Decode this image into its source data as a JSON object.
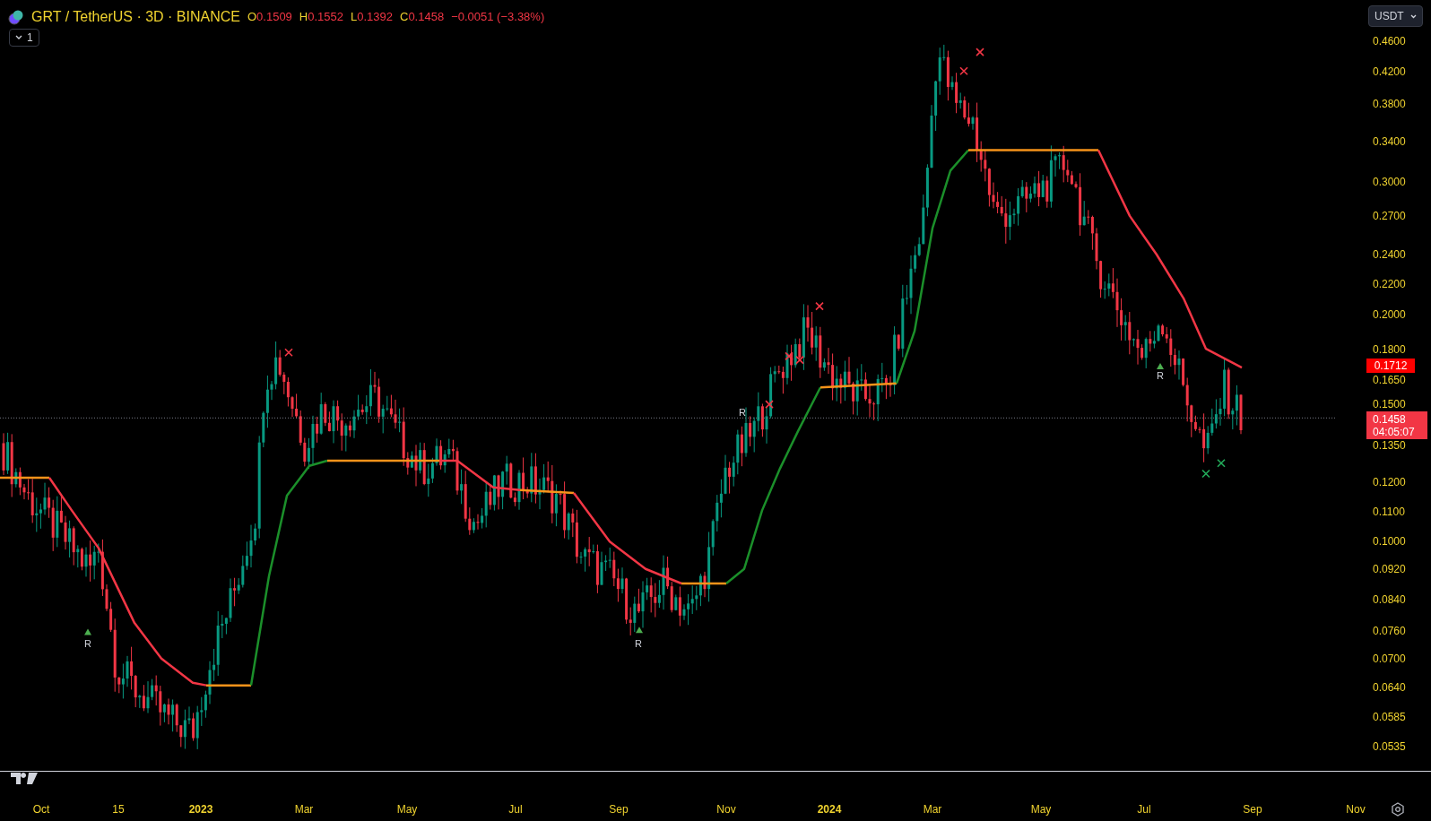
{
  "symbol": {
    "title": "GRT / TetherUS · 3D · BINANCE",
    "ohlc": [
      {
        "label": "O",
        "value": "0.1509"
      },
      {
        "label": "H",
        "value": "0.1552"
      },
      {
        "label": "L",
        "value": "0.1392"
      },
      {
        "label": "C",
        "value": "0.1458"
      }
    ],
    "change": "−0.0051 (−3.38%)"
  },
  "indicator_toggle": {
    "count": "1",
    "expanded": false
  },
  "currency_button": "USDT",
  "price_axis": {
    "ticks": [
      "0.4600",
      "0.4200",
      "0.3800",
      "0.3400",
      "0.3000",
      "0.2700",
      "0.2400",
      "0.2200",
      "0.2000",
      "0.1800",
      "0.1650",
      "0.1500",
      "0.1350",
      "0.1200",
      "0.1100",
      "0.1000",
      "0.0920",
      "0.0840",
      "0.0760",
      "0.0700",
      "0.0640",
      "0.0585",
      "0.0535"
    ]
  },
  "indicator_price": "0.1712",
  "last_price": {
    "price": "0.1458",
    "countdown": "04:05:07"
  },
  "signal_labels": [
    "R",
    "R",
    "R",
    "R"
  ],
  "time_axis": {
    "ticks": [
      {
        "label": "Oct",
        "kind": "month"
      },
      {
        "label": "15",
        "kind": "month"
      },
      {
        "label": "2023",
        "kind": "year"
      },
      {
        "label": "Mar",
        "kind": "month"
      },
      {
        "label": "May",
        "kind": "month"
      },
      {
        "label": "Jul",
        "kind": "month"
      },
      {
        "label": "Sep",
        "kind": "month"
      },
      {
        "label": "Nov",
        "kind": "month"
      },
      {
        "label": "2024",
        "kind": "year"
      },
      {
        "label": "Mar",
        "kind": "month"
      },
      {
        "label": "May",
        "kind": "month"
      },
      {
        "label": "Jul",
        "kind": "month"
      },
      {
        "label": "Sep",
        "kind": "month"
      },
      {
        "label": "Nov",
        "kind": "month"
      }
    ]
  }
}
